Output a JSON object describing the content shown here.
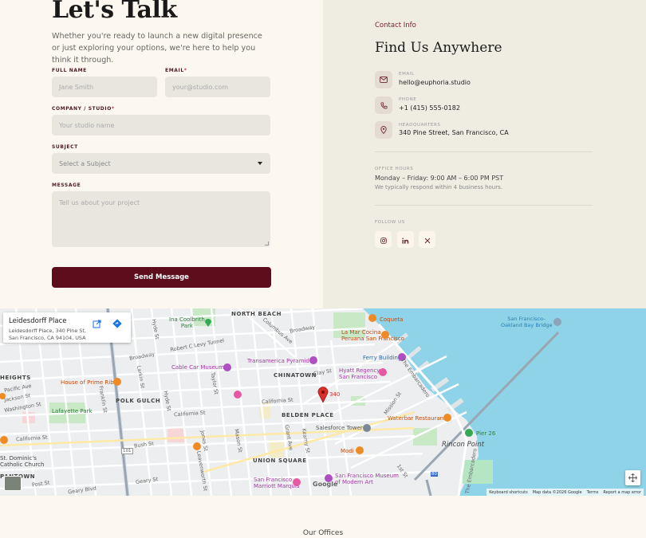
{
  "hero": {
    "title": "Let's Talk",
    "intro": "Whether you're ready to launch a new digital presence or just exploring your options, we're here to help you think it through."
  },
  "form": {
    "full_name_label": "FULL NAME",
    "full_name_placeholder": "Jane Smith",
    "email_label": "EMAIL",
    "email_required": "*",
    "email_placeholder": "your@studio.com",
    "company_label": "COMPANY / STUDIO",
    "company_required": "*",
    "company_placeholder": "Your studio name",
    "subject_label": "SUBJECT",
    "subject_selected": "Select a Subject",
    "message_label": "MESSAGE",
    "message_placeholder": "Tell us about your project",
    "submit_label": "Send Message"
  },
  "contact": {
    "section_label": "Contact Info",
    "title": "Find Us Anywhere",
    "email_label": "EMAIL",
    "email_value": "hello@euphoria.studio",
    "phone_label": "PHONE",
    "phone_value": "+1 (415) 555-0182",
    "hq_label": "HEADQUARTERS",
    "hq_value": "340 Pine Street, San Francisco, CA",
    "hours_label": "OFFICE HOURS",
    "hours_value": "Monday – Friday: 9:00 AM – 6:00 PM PST",
    "hours_note": "We typically respond within 4 business hours.",
    "follow_label": "FOLLOW US"
  },
  "social": [
    "instagram-icon",
    "linkedin-icon",
    "x-icon"
  ],
  "map": {
    "card_title": "Leidesdorff Place",
    "card_address": "Leidesdorff Place, 340 Pine St, San Francisco, CA 94104, USA",
    "marker_number": "340",
    "google_logo": "Google",
    "attribution": [
      "Keyboard shortcuts",
      "Map data ©2026 Google",
      "Terms",
      "Report a map error"
    ],
    "neighborhoods": {
      "north_beach": "NORTH BEACH",
      "chinatown": "CHINATOWN",
      "polk_gulch": "POLK GULCH",
      "belden_place": "BELDEN PLACE",
      "union_square": "UNION SQUARE",
      "heights": "HEIGHTS",
      "pantown": "PANTOWN"
    },
    "pois": {
      "ina_coolbrith": "Ina Coolbrith\nPark",
      "coqueta": "Coqueta",
      "la_mar": "La Mar Cocina\nPeruana San Francisco",
      "ferry_building": "Ferry Building",
      "cable_car": "Cable Car Museum",
      "transamerica": "Transamerica Pyramid",
      "hyatt": "Hyatt Regency\nSan Francisco",
      "house_prime_rib": "House of Prime Rib",
      "lafayette": "Lafayette Park",
      "waterbar": "Waterbar Restaurant",
      "pier26": "Pier 26",
      "salesforce": "Salesforce Tower",
      "modi": "Modi",
      "sf_moma": "San Francisco Museum\nof Modern Art",
      "sf_marriott": "San Francisco\nMarriott Marquis",
      "st_dominic": "St. Dominic's\nCatholic Church",
      "rincon": "Rincon Point",
      "bay_bridge": "San Francisco–\nOakland Bay Bridge"
    },
    "streets": {
      "broadway": "Broadway",
      "broadway2": "Broadway",
      "columbus": "Columbus Ave",
      "robert_levy": "Robert C Levy Tunnel",
      "pacific": "Pacific Ave",
      "jackson": "Jackson St",
      "washington": "Washington St",
      "california": "California St",
      "california2": "California St",
      "california3": "California St",
      "bush": "Bush St",
      "geary": "Geary St",
      "geary_blvd": "Geary Blvd",
      "post": "Post St",
      "hyde": "Hyde St",
      "larkin": "Larkin St",
      "franklin": "Franklin St",
      "jones": "Jones St",
      "mason": "Mason St",
      "taylor": "Taylor St",
      "leavenworth": "Leavenworth St",
      "grant": "Grant Ave",
      "kearny": "Kearny St",
      "mission": "Mission St",
      "embarcadero": "The Embarcadero",
      "first": "1st St",
      "clay": "Clay St",
      "hwy101": "101",
      "i80": "80"
    }
  },
  "footer": {
    "offices_title": "Our Offices"
  },
  "colors": {
    "accent": "#5e0d1c",
    "left_bg": "#fdf8ef",
    "right_bg": "#efede2",
    "field_bg": "#e8e6df",
    "water": "#8fd3e8"
  }
}
